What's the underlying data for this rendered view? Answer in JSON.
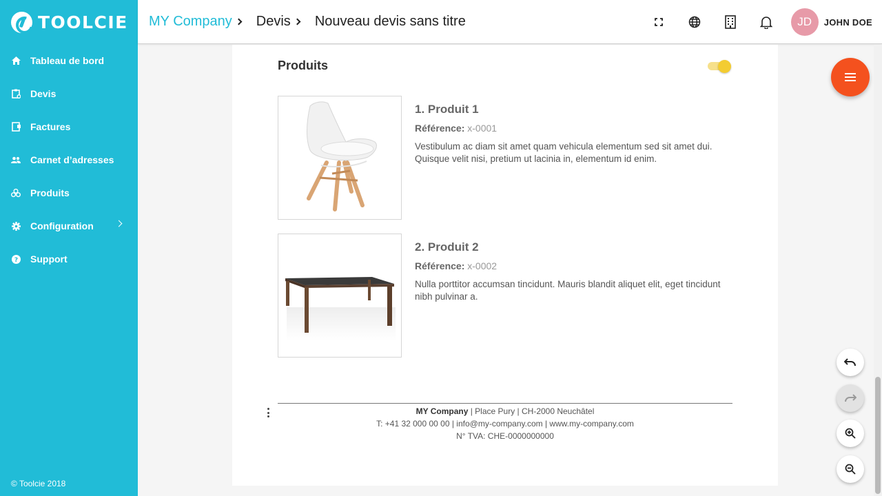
{
  "brand": {
    "name": "TOOLCIE"
  },
  "sidebar": {
    "items": [
      {
        "label": "Tableau de bord",
        "icon": "home-icon"
      },
      {
        "label": "Devis",
        "icon": "quote-icon"
      },
      {
        "label": "Factures",
        "icon": "invoice-icon"
      },
      {
        "label": "Carnet d’adresses",
        "icon": "contacts-icon"
      },
      {
        "label": "Produits",
        "icon": "products-icon"
      },
      {
        "label": "Configuration",
        "icon": "gear-icon",
        "has_submenu": true
      },
      {
        "label": "Support",
        "icon": "help-icon"
      }
    ],
    "copyright": "© Toolcie 2018"
  },
  "header": {
    "breadcrumbs": [
      "MY Company",
      "Devis",
      "Nouveau devis sans titre"
    ],
    "user": {
      "initials": "JD",
      "name": "JOHN DOE"
    },
    "icons": [
      "fullscreen-icon",
      "globe-icon",
      "building-icon",
      "bell-icon"
    ]
  },
  "document": {
    "section_title": "Produits",
    "toggle_on": true,
    "products": [
      {
        "name": "1. Produit 1",
        "reference_label": "Référence:",
        "reference": "x-0001",
        "description": "Vestibulum ac diam sit amet quam vehicula elementum sed sit amet dui. Quisque velit nisi, pretium ut lacinia in, elementum id enim.",
        "image": "chair-image"
      },
      {
        "name": "2. Produit 2",
        "reference_label": "Référence:",
        "reference": "x-0002",
        "description": "Nulla porttitor accumsan tincidunt. Mauris blandit aliquet elit, eget tincidunt nibh pulvinar a.",
        "image": "table-image"
      }
    ],
    "footer": {
      "company": "MY Company",
      "address": " | Place Pury | CH-2000 Neuchâtel",
      "contact": "T: +41 32 000 00 00 | info@my-company.com | www.my-company.com",
      "vat": "N° TVA: CHE-0000000000"
    }
  },
  "colors": {
    "sidebar": "#21bcd7",
    "fab": "#f4511e",
    "avatar": "#e79aa8",
    "toggle": "#f3cc31"
  }
}
